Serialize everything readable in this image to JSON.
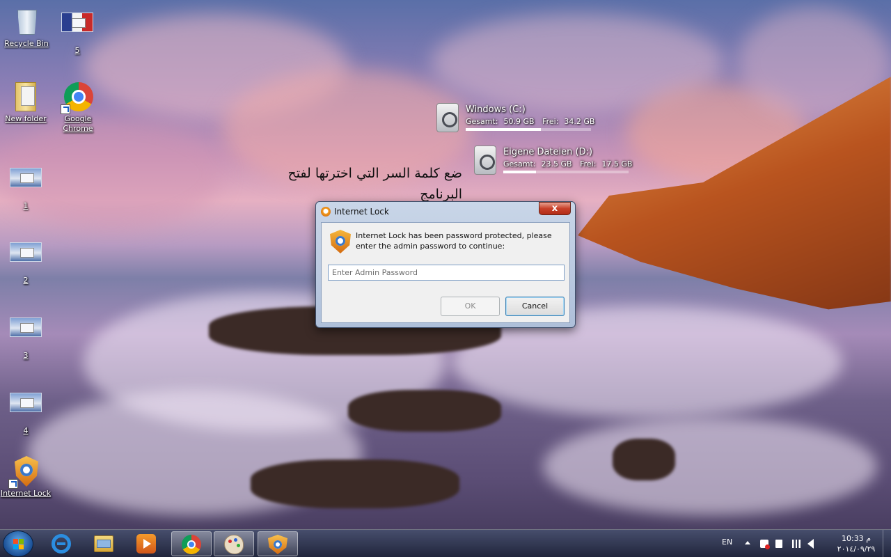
{
  "desktop": {
    "icons": [
      {
        "label": "Recycle Bin",
        "icon": "recycle-bin-icon"
      },
      {
        "label": "5",
        "icon": "screenshot-thumbnail-icon"
      },
      {
        "label": "New folder",
        "icon": "folder-icon"
      },
      {
        "label": "Google Chrome",
        "icon": "chrome-icon"
      },
      {
        "label": "1",
        "icon": "screenshot-thumbnail-icon"
      },
      {
        "label": "2",
        "icon": "screenshot-thumbnail-icon"
      },
      {
        "label": "3",
        "icon": "screenshot-thumbnail-icon"
      },
      {
        "label": "4",
        "icon": "screenshot-thumbnail-icon"
      },
      {
        "label": "Internet Lock",
        "icon": "internet-lock-icon"
      }
    ]
  },
  "drives": [
    {
      "name": "Windows (C:)",
      "used_label": "Gesamt:",
      "used": "50.9 GB",
      "free_label": "Frei:",
      "free": "34.2 GB",
      "used_fraction": 0.6
    },
    {
      "name": "Eigene Dateien (D:)",
      "used_label": "Gesamt:",
      "used": "23.5 GB",
      "free_label": "Frei:",
      "free": "17.5 GB",
      "used_fraction": 0.26
    }
  ],
  "annotation": {
    "text": "ضع كلمة السر التي اخترتها لفتح البرنامج"
  },
  "dialog": {
    "title": "Internet Lock",
    "close_label": "x",
    "message": "Internet Lock has been password protected, please enter the admin password to continue:",
    "password_value": "",
    "password_placeholder": "Enter Admin Password",
    "ok_label": "OK",
    "cancel_label": "Cancel",
    "ok_enabled": false
  },
  "taskbar": {
    "pinned": [
      {
        "name": "internet-explorer",
        "icon": "internet-explorer-icon"
      },
      {
        "name": "file-explorer",
        "icon": "file-explorer-icon"
      },
      {
        "name": "media-player",
        "icon": "media-player-icon"
      },
      {
        "name": "chrome",
        "icon": "chrome-icon"
      },
      {
        "name": "paint",
        "icon": "paint-icon"
      },
      {
        "name": "internet-lock",
        "icon": "internet-lock-icon"
      }
    ],
    "tray": {
      "language": "EN",
      "time": "10:33 م",
      "date": "٢٠١٤/٠٩/٢٩"
    }
  },
  "colors": {
    "accent": "#1b4f95",
    "close_red": "#c8412a",
    "shield_orange": "#f39a1c"
  }
}
